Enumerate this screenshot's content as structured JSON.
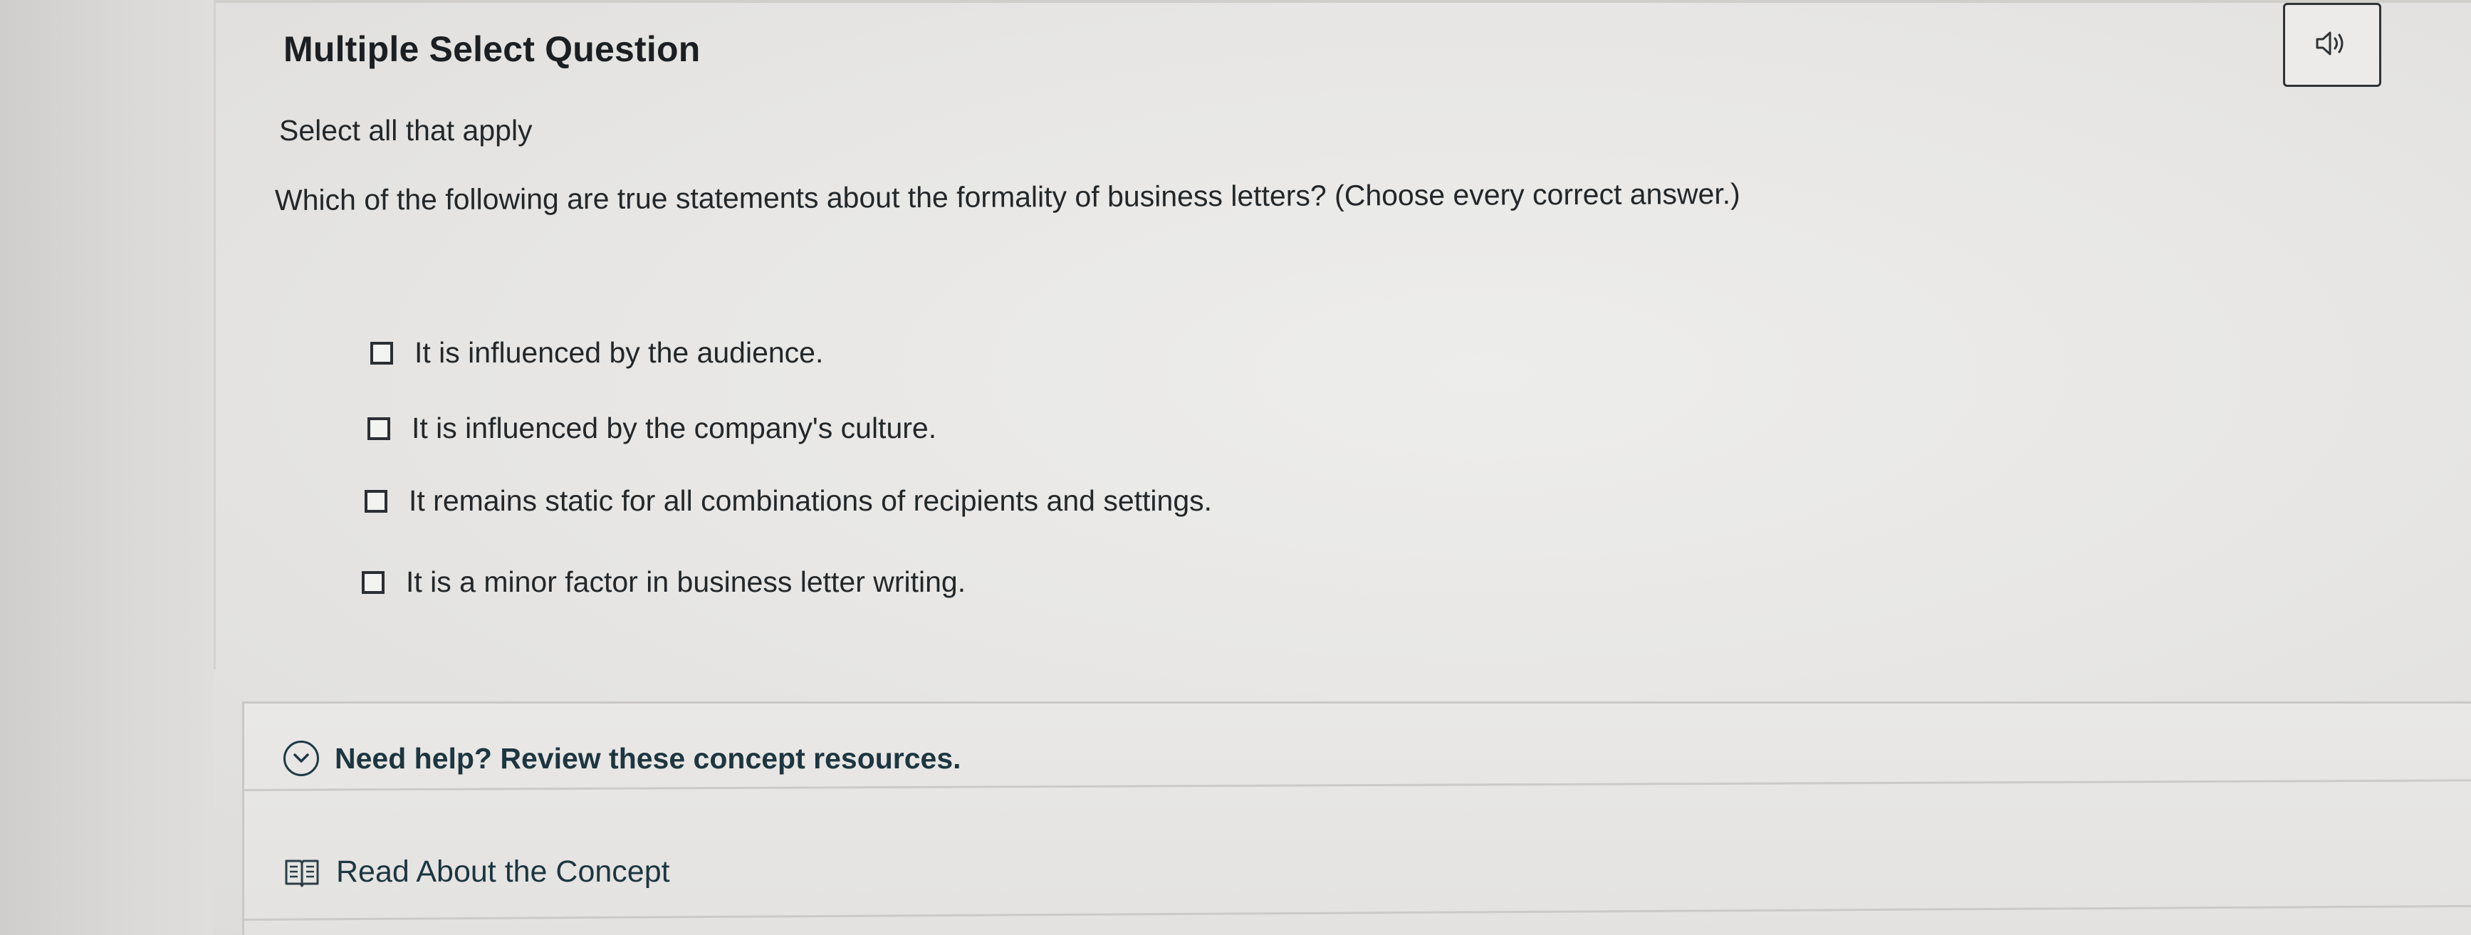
{
  "question": {
    "header": "Multiple Select Question",
    "instruction": "Select all that apply",
    "prompt": "Which of the following are true statements about the formality of business letters? (Choose every correct answer.)"
  },
  "options": [
    {
      "label": "It is influenced by the audience.",
      "checked": false
    },
    {
      "label": "It is influenced by the company's culture.",
      "checked": false
    },
    {
      "label": "It remains static for all combinations of recipients and settings.",
      "checked": false
    },
    {
      "label": "It is a minor factor in business letter writing.",
      "checked": false
    }
  ],
  "help": {
    "toggle_label": "Need help? Review these concept resources.",
    "resource_label": "Read About the Concept"
  },
  "icons": {
    "audio": "speaker-icon",
    "toggle": "chevron-down-circle-icon",
    "resource": "book-icon"
  },
  "colors": {
    "text": "#23272a",
    "accent": "#1d3640"
  }
}
